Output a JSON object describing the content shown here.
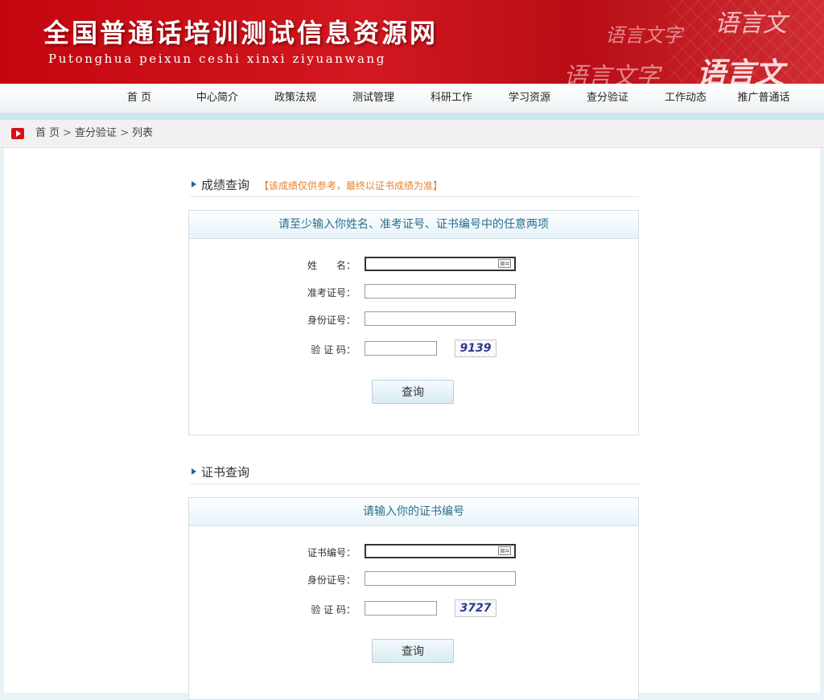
{
  "header": {
    "site_title": "全国普通话培训测试信息资源网",
    "site_subtitle": "Putonghua peixun ceshi xinxi ziyuanwang",
    "deco_texts": [
      "语言文字",
      "语言文",
      "语言文字",
      "语言文"
    ]
  },
  "nav": {
    "items": [
      "首 页",
      "中心简介",
      "政策法规",
      "测试管理",
      "科研工作",
      "学习资源",
      "查分验证",
      "工作动态",
      "推广普通话"
    ]
  },
  "breadcrumb": {
    "items": [
      "首 页",
      "查分验证",
      "列表"
    ],
    "separator": ">"
  },
  "score_query": {
    "title": "成绩查询",
    "note": "【该成绩仅供参考，最终以证书成绩为准】",
    "panel_title": "请至少输入你姓名、准考证号、证书编号中的任意两项",
    "name_label": "姓　　名：",
    "name_value": "",
    "exam_id_label": "准考证号：",
    "exam_id_value": "",
    "id_card_label": "身份证号：",
    "id_card_value": "",
    "captcha_label": "验 证 码：",
    "captcha_value": "",
    "captcha_code": "9139",
    "submit_label": "查询"
  },
  "cert_query": {
    "title": "证书查询",
    "panel_title": "请输入你的证书编号",
    "cert_no_label": "证书编号：",
    "cert_no_value": "",
    "id_card_label": "身份证号：",
    "id_card_value": "",
    "captcha_label": "验 证 码：",
    "captcha_value": "",
    "captcha_code": "3727",
    "submit_label": "查询"
  },
  "colors": {
    "banner_red": "#c4060f",
    "panel_title_blue": "#2a6f8c",
    "note_orange": "#e8822a",
    "breadcrumb_icon_red": "#d8101c"
  },
  "icons": {
    "breadcrumb": "play-icon",
    "section": "triangle-right-icon",
    "input_helper": "id-card-icon"
  }
}
